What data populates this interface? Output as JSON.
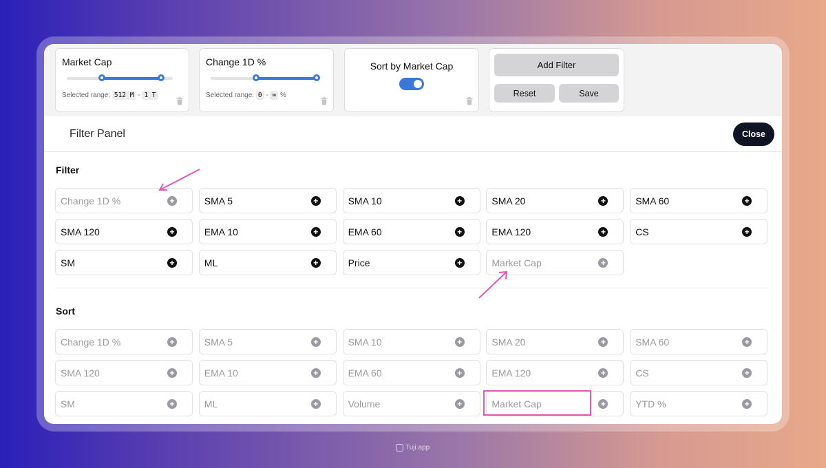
{
  "colors": {
    "accent": "#3a78d8",
    "highlight": "#e356b8",
    "close_bg": "#0f1424"
  },
  "top_cards": {
    "market_cap": {
      "title": "Market Cap",
      "range_label": "Selected range:",
      "range_min": "512 M",
      "range_sep": "-",
      "range_max": "1 T",
      "slider_start": 0.33,
      "slider_end": 0.89,
      "icon": "trash-icon"
    },
    "change_1d": {
      "title": "Change 1D %",
      "range_label": "Selected range:",
      "range_min": "0",
      "range_sep": "-",
      "range_max": "∞",
      "range_unit": "%",
      "slider_start": 0.43,
      "slider_end": 1.0,
      "icon": "trash-icon"
    },
    "sort": {
      "title": "Sort by Market Cap",
      "toggle_on": true,
      "icon": "trash-icon"
    },
    "actions": {
      "add_filter": "Add Filter",
      "reset": "Reset",
      "save": "Save"
    }
  },
  "panel": {
    "title": "Filter Panel",
    "close": "Close"
  },
  "filter": {
    "title": "Filter",
    "items": [
      {
        "label": "Change 1D %",
        "disabled": true
      },
      {
        "label": "SMA 5",
        "disabled": false
      },
      {
        "label": "SMA 10",
        "disabled": false
      },
      {
        "label": "SMA 20",
        "disabled": false
      },
      {
        "label": "SMA 60",
        "disabled": false
      },
      {
        "label": "SMA 120",
        "disabled": false
      },
      {
        "label": "EMA 10",
        "disabled": false
      },
      {
        "label": "EMA 60",
        "disabled": false
      },
      {
        "label": "EMA 120",
        "disabled": false
      },
      {
        "label": "CS",
        "disabled": false
      },
      {
        "label": "SM",
        "disabled": false
      },
      {
        "label": "ML",
        "disabled": false
      },
      {
        "label": "Price",
        "disabled": false
      },
      {
        "label": "Market Cap",
        "disabled": true
      }
    ]
  },
  "sort": {
    "title": "Sort",
    "items": [
      {
        "label": "Change 1D %",
        "disabled": true
      },
      {
        "label": "SMA 5",
        "disabled": true
      },
      {
        "label": "SMA 10",
        "disabled": true
      },
      {
        "label": "SMA 20",
        "disabled": true
      },
      {
        "label": "SMA 60",
        "disabled": true
      },
      {
        "label": "SMA 120",
        "disabled": true
      },
      {
        "label": "EMA 10",
        "disabled": true
      },
      {
        "label": "EMA 60",
        "disabled": true
      },
      {
        "label": "EMA 120",
        "disabled": true
      },
      {
        "label": "CS",
        "disabled": true
      },
      {
        "label": "SM",
        "disabled": true
      },
      {
        "label": "ML",
        "disabled": true
      },
      {
        "label": "Volume",
        "disabled": true
      },
      {
        "label": "Market Cap",
        "disabled": true
      },
      {
        "label": "YTD %",
        "disabled": true
      }
    ]
  },
  "watermark": {
    "text": "Tuji.app"
  }
}
